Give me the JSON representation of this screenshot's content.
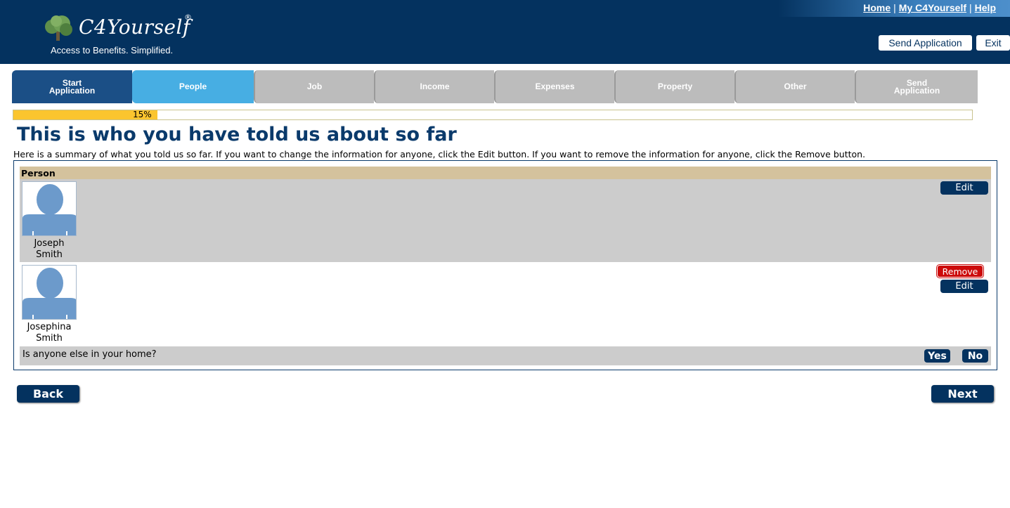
{
  "header": {
    "logo_text": "C4Yourself",
    "logo_reg": "®",
    "tagline": "Access to Benefits.  Simplified.",
    "links": [
      "Home",
      "My C4Yourself",
      "Help"
    ],
    "link_separator": "|",
    "send_application_label": "Send Application",
    "exit_label": "Exit"
  },
  "steps": [
    {
      "label": "Start Application",
      "state": "done"
    },
    {
      "label": "People",
      "state": "current"
    },
    {
      "label": "Job",
      "state": "todo"
    },
    {
      "label": "Income",
      "state": "todo"
    },
    {
      "label": "Expenses",
      "state": "todo"
    },
    {
      "label": "Property",
      "state": "todo"
    },
    {
      "label": "Other",
      "state": "todo"
    },
    {
      "label": "Send Application",
      "state": "todo"
    }
  ],
  "progress": {
    "percent": 15,
    "label": "15%"
  },
  "title": "This is who you have told us about so far",
  "intro": "Here is a summary of what you told us so far. If you want to change the information for anyone, click the Edit button. If you want to remove the information for anyone, click the Remove button.",
  "summary": {
    "column_header": "Person",
    "people": [
      {
        "first": "Joseph",
        "last": "Smith",
        "edit_label": "Edit"
      },
      {
        "first": "Josephina",
        "last": "Smith",
        "edit_label": "Edit",
        "remove_label": "Remove"
      }
    ],
    "question": "Is anyone else in your home?",
    "yes_label": "Yes",
    "no_label": "No"
  },
  "nav": {
    "back_label": "Back",
    "next_label": "Next"
  },
  "colors": {
    "header_bg": "#04325f",
    "step_done": "#1b4f86",
    "step_current": "#47aee3",
    "step_todo": "#bcbcbc",
    "progress_fill": "#fbc52e",
    "remove_red": "#cc0a0a",
    "avatar_blue": "#6c9acb"
  }
}
